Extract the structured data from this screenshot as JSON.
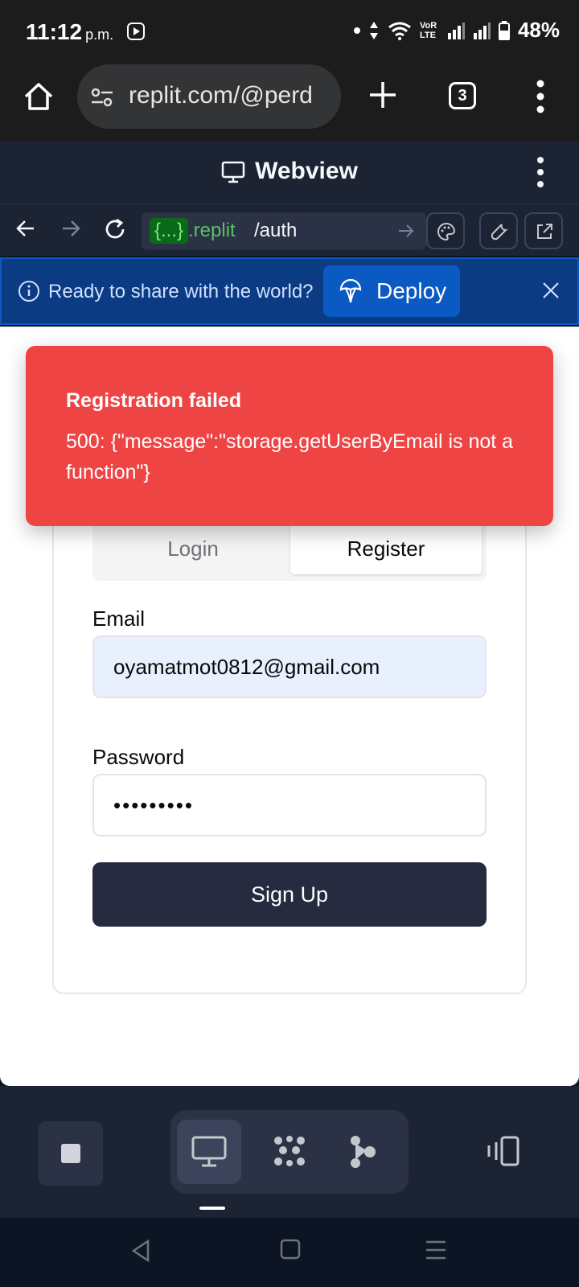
{
  "status_bar": {
    "time": "11:12",
    "ampm": "p.m.",
    "network_label": "VoR LTE",
    "battery": "48%"
  },
  "browser": {
    "url": "replit.com/@perd",
    "tab_count": "3"
  },
  "webview": {
    "title": "Webview",
    "url_chip": "{...}",
    "url_domain": ".replit",
    "url_path": "/auth"
  },
  "deploy_banner": {
    "text": "Ready to share with the world?",
    "button": "Deploy"
  },
  "toast": {
    "title": "Registration failed",
    "message": "500: {\"message\":\"storage.getUserByEmail is not a function\"}"
  },
  "auth_form": {
    "tabs": [
      {
        "label": "Login",
        "active": false
      },
      {
        "label": "Register",
        "active": true
      }
    ],
    "email_label": "Email",
    "email_value": "oyamatmot0812@gmail.com",
    "password_label": "Password",
    "password_value": "•••••••••",
    "submit_label": "Sign Up"
  },
  "colors": {
    "toast_bg": "#ef4444",
    "deploy_bg": "#0a3b83",
    "button_dark": "#262b3f"
  }
}
